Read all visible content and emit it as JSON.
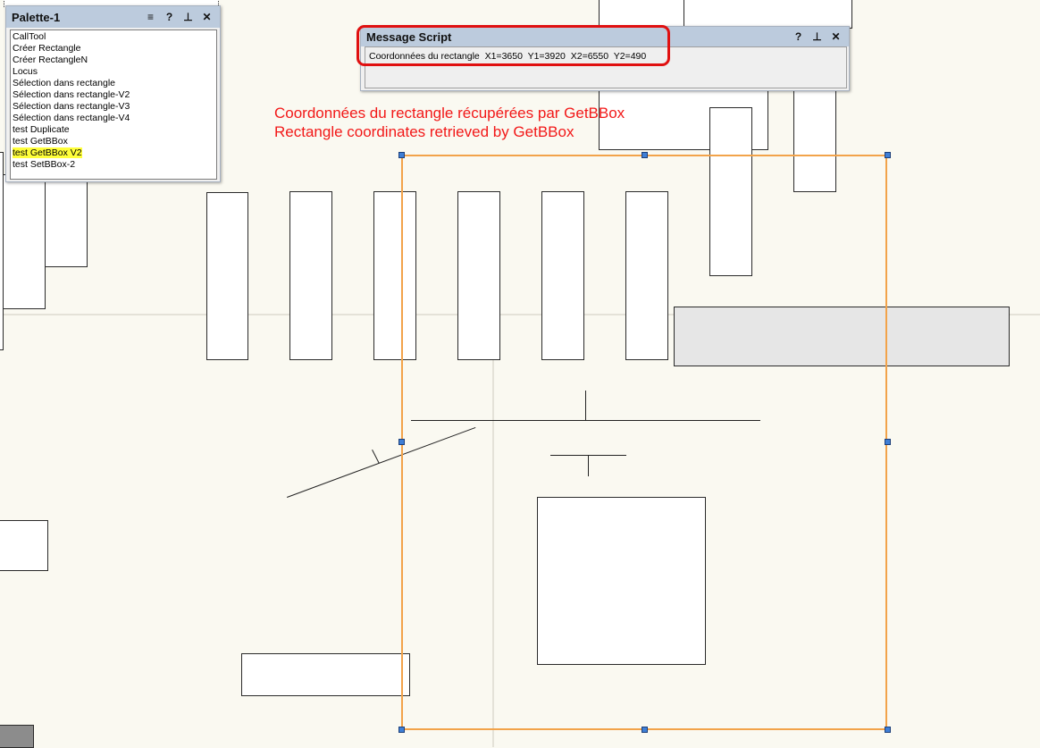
{
  "palette": {
    "title": "Palette-1",
    "buttons": [
      "≡",
      "?",
      "⊥",
      "✕"
    ],
    "items": [
      {
        "label": "CallTool",
        "highlighted": false
      },
      {
        "label": "Créer Rectangle",
        "highlighted": false
      },
      {
        "label": "Créer RectangleN",
        "highlighted": false
      },
      {
        "label": "Locus",
        "highlighted": false
      },
      {
        "label": "Sélection dans rectangle",
        "highlighted": false
      },
      {
        "label": "Sélection dans rectangle-V2",
        "highlighted": false
      },
      {
        "label": "Sélection dans rectangle-V3",
        "highlighted": false
      },
      {
        "label": "Sélection dans rectangle-V4",
        "highlighted": false
      },
      {
        "label": "test Duplicate",
        "highlighted": false
      },
      {
        "label": "test GetBBox",
        "highlighted": false
      },
      {
        "label": "test GetBBox V2",
        "highlighted": true
      },
      {
        "label": "test SetBBox-2",
        "highlighted": false
      }
    ]
  },
  "message_script": {
    "title": "Message Script",
    "buttons": [
      "?",
      "⊥",
      "✕"
    ],
    "message": "Coordonnées du rectangle  X1=3650  Y1=3920  X2=6550  Y2=490"
  },
  "annotation": {
    "line1": "Coordonnées du rectangle récupérées par GetBBox",
    "line2": "Rectangle coordinates retrieved by GetBBox"
  },
  "colors": {
    "canvas": "#faf9f1",
    "highlight": "#ffff3a",
    "annotation": "#f21818",
    "bbox_outline": "#f2a34a",
    "handle": "#3f7fd6"
  }
}
